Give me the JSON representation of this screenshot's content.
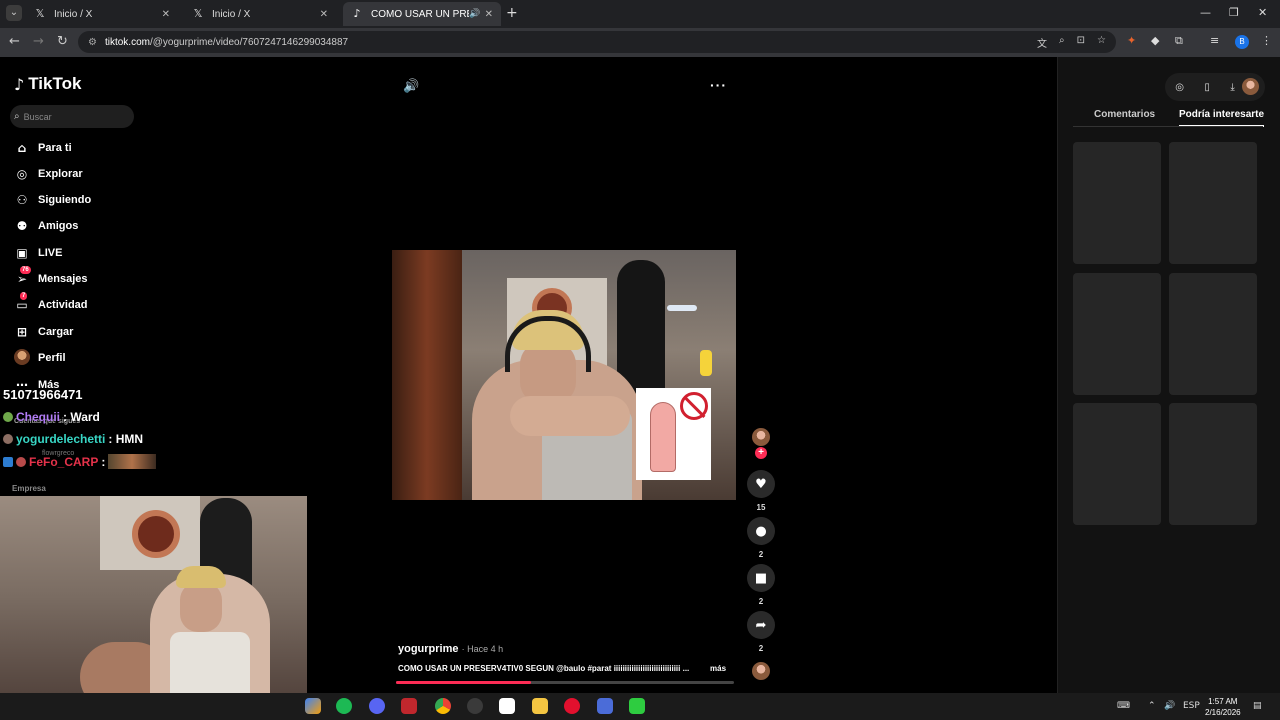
{
  "browser": {
    "tabs": [
      {
        "label": "Inicio / X",
        "icon": "x-logo-icon"
      },
      {
        "label": "Inicio / X",
        "icon": "x-logo-icon"
      },
      {
        "label": "COMO USAR UN PRESERV",
        "icon": "tiktok-icon",
        "active": true
      }
    ],
    "url_host": "tiktok.com",
    "url_path": "/@yogurprime/video/7607247146299034887",
    "profile_initial": "B"
  },
  "tiktok": {
    "logo": "TikTok",
    "search_placeholder": "Buscar",
    "nav": [
      {
        "label": "Para ti",
        "icon": "home-icon"
      },
      {
        "label": "Explorar",
        "icon": "compass-icon"
      },
      {
        "label": "Siguiendo",
        "icon": "following-icon"
      },
      {
        "label": "Amigos",
        "icon": "friends-icon"
      },
      {
        "label": "LIVE",
        "icon": "live-icon"
      },
      {
        "label": "Mensajes",
        "icon": "messages-icon",
        "badge": "76"
      },
      {
        "label": "Actividad",
        "icon": "activity-icon",
        "badge": "7"
      },
      {
        "label": "Cargar",
        "icon": "upload-icon"
      },
      {
        "label": "Perfil",
        "icon": "profile-avatar"
      },
      {
        "label": "Más",
        "icon": "more-icon"
      }
    ],
    "following_heading": "Cuentas que sigues",
    "following_name": "flowrgreco",
    "company": "Empresa",
    "video": {
      "author": "yogurprime",
      "time": "· Hace 4 h",
      "caption": "COMO USAR UN PRESERV4TIV0 SEGUN @baulo #parat iiiiiiiiiiiiiiiiiiiiiiiiiiiiii ...",
      "more_label": "más",
      "progress": 0.4
    },
    "actions": {
      "likes": "15",
      "comments": "2",
      "saves": "2",
      "shares": "2"
    },
    "right_tabs": [
      "Comentarios",
      "Podría interesarte"
    ]
  },
  "stream_overlay": {
    "counter": "51071966471",
    "chat": [
      {
        "user": "Chequii",
        "message": ": Ward"
      },
      {
        "user": "yogurdelechetti",
        "message": ": HMN"
      },
      {
        "user": "FeFo_CARP",
        "message": ":"
      }
    ]
  },
  "taskbar": {
    "lang": "ESP",
    "time": "1:57 AM",
    "date": "2/16/2026"
  }
}
